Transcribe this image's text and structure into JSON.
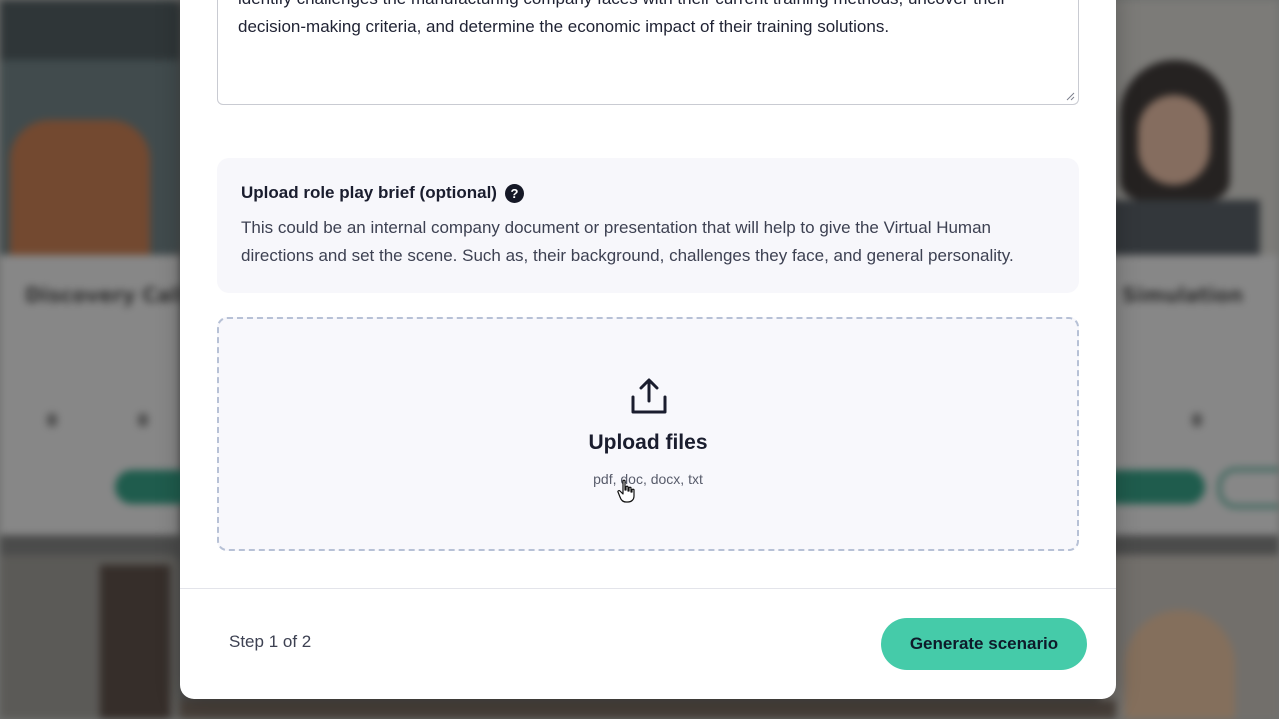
{
  "background": {
    "card_titles": [
      "Discovery Call",
      "Simulation"
    ]
  },
  "modal": {
    "objective_text": {
      "line1": "identify challenges the manufacturing company faces with their current training methods, uncover their",
      "line2": "decision-making criteria, and determine the economic impact of their training solutions."
    },
    "brief": {
      "heading": "Upload role play brief (optional)",
      "help_icon": "?",
      "description_line1": "This could be an internal company document or presentation that will help to give the Virtual Human",
      "description_line2": "directions and set the scene. Such as, their background, challenges they face, and general personality."
    },
    "upload": {
      "icon": "upload-icon",
      "title": "Upload files",
      "formats": "pdf, doc, docx, txt"
    },
    "footer": {
      "step": "Step 1 of 2",
      "generate_label": "Generate scenario"
    }
  },
  "colors": {
    "accent": "#45cba9",
    "dropzone_border": "#b7c1d6",
    "text_dark": "#1a1d2e"
  }
}
